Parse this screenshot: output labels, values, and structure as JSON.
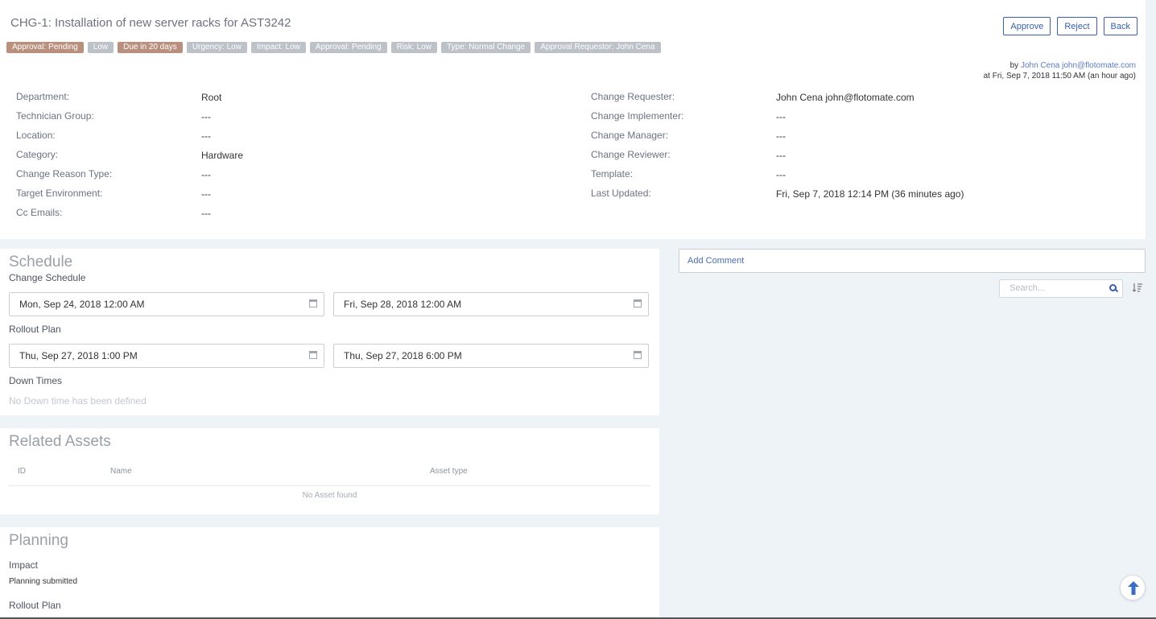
{
  "header": {
    "title": "CHG-1: Installation of new server racks for AST3242",
    "actions": {
      "approve": "Approve",
      "reject": "Reject",
      "back": "Back"
    },
    "badges": [
      {
        "text": "Approval: Pending",
        "color": "#b98f7d"
      },
      {
        "text": "Low",
        "color": "#bcc2c8"
      },
      {
        "text": "Due in 20 days",
        "color": "#b98f7d"
      },
      {
        "text": "Urgency: Low",
        "color": "#bcc2c8"
      },
      {
        "text": "Impact: Low",
        "color": "#bcc2c8"
      },
      {
        "text": "Approval: Pending",
        "color": "#bcc2c8"
      },
      {
        "text": "Risk: Low",
        "color": "#bcc2c8"
      },
      {
        "text": "Type: Normal Change",
        "color": "#bcc2c8"
      },
      {
        "text": "Approval Requestor: John Cena",
        "color": "#bcc2c8"
      }
    ],
    "byline": {
      "by": "by",
      "name": "John Cena",
      "email": "john@flotomate.com",
      "at": "at Fri, Sep 7, 2018 11:50 AM (an hour ago)"
    }
  },
  "fields_left": [
    {
      "label": "Department:",
      "value": "Root"
    },
    {
      "label": "Technician Group:",
      "value": "---"
    },
    {
      "label": "Location:",
      "value": "---"
    },
    {
      "label": "Category:",
      "value": "Hardware"
    },
    {
      "label": "Change Reason Type:",
      "value": "---"
    },
    {
      "label": "Target Environment:",
      "value": "---"
    },
    {
      "label": "Cc Emails:",
      "value": "---"
    }
  ],
  "fields_right": [
    {
      "label": "Change Requester:",
      "value": "John Cena john@flotomate.com"
    },
    {
      "label": "Change Implementer:",
      "value": "---"
    },
    {
      "label": "Change Manager:",
      "value": "---"
    },
    {
      "label": "Change Reviewer:",
      "value": "---"
    },
    {
      "label": "Template:",
      "value": "---"
    },
    {
      "label": "Last Updated:",
      "value": "Fri, Sep 7, 2018 12:14 PM (36 minutes ago)"
    }
  ],
  "schedule": {
    "title": "Schedule",
    "change_schedule_label": "Change Schedule",
    "change_start": "Mon, Sep 24, 2018 12:00 AM",
    "change_end": "Fri, Sep 28, 2018 12:00 AM",
    "rollout_label": "Rollout Plan",
    "rollout_start": "Thu, Sep 27, 2018 1:00 PM",
    "rollout_end": "Thu, Sep 27, 2018 6:00 PM",
    "downtimes_label": "Down Times",
    "downtimes_empty": "No Down time has been defined"
  },
  "assets": {
    "title": "Related Assets",
    "columns": [
      "ID",
      "Name",
      "Asset type"
    ],
    "empty": "No Asset found"
  },
  "planning": {
    "title": "Planning",
    "impact_label": "Impact",
    "impact_value": "Planning submitted",
    "rollout_label": "Rollout Plan"
  },
  "comments": {
    "add_comment": "Add Comment",
    "search_placeholder": "Search..."
  }
}
